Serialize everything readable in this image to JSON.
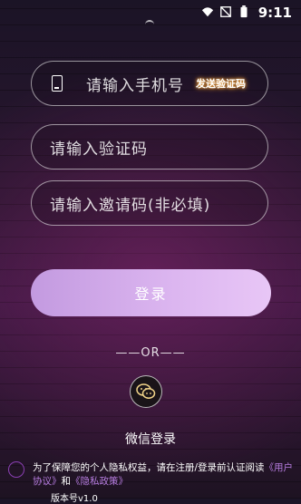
{
  "status_bar": {
    "time": "9:11"
  },
  "form": {
    "phone_placeholder": "请输入手机号",
    "send_code_label": "发送验证码",
    "code_placeholder": "请输入验证码",
    "invite_placeholder": "请输入邀请码(非必填)"
  },
  "login_button": "登录",
  "divider": "——OR——",
  "wechat_label": "微信登录",
  "agreement": {
    "text_before": "为了保障您的个人隐私权益，请在注册/登录前认证阅读",
    "user_agreement": "《用户协议》",
    "and": "和",
    "privacy_policy": "《隐私政策》"
  },
  "version": "版本号v1.0"
}
